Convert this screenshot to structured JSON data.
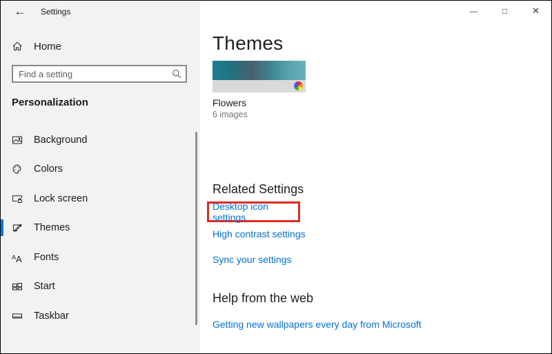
{
  "window": {
    "title": "Settings",
    "back_glyph": "←",
    "controls": {
      "minimize": "—",
      "maximize": "□",
      "close": "✕"
    }
  },
  "sidebar": {
    "home": {
      "label": "Home"
    },
    "search": {
      "placeholder": "Find a setting"
    },
    "section_header": "Personalization",
    "items": [
      {
        "label": "Background",
        "icon": "image-icon",
        "selected": false
      },
      {
        "label": "Colors",
        "icon": "palette-icon",
        "selected": false
      },
      {
        "label": "Lock screen",
        "icon": "lock-screen-icon",
        "selected": false
      },
      {
        "label": "Themes",
        "icon": "themes-icon",
        "selected": true
      },
      {
        "label": "Fonts",
        "icon": "fonts-icon",
        "selected": false
      },
      {
        "label": "Start",
        "icon": "start-tiles-icon",
        "selected": false
      },
      {
        "label": "Taskbar",
        "icon": "taskbar-icon",
        "selected": false
      }
    ]
  },
  "main": {
    "page_title": "Themes",
    "current_theme": {
      "name": "Flowers",
      "image_count": "6 images"
    },
    "related_settings": {
      "heading": "Related Settings",
      "links": [
        {
          "label": "Desktop icon settings",
          "highlighted": true
        },
        {
          "label": "High contrast settings",
          "highlighted": false
        },
        {
          "label": "Sync your settings",
          "highlighted": false
        }
      ]
    },
    "help": {
      "heading": "Help from the web",
      "links": [
        {
          "label": "Getting new wallpapers every day from Microsoft"
        }
      ]
    }
  },
  "colors": {
    "accent": "#0078d7",
    "link": "#0070d6",
    "annotation_box": "#e0291d",
    "sidebar_bg": "#f2f2f2",
    "thumbnail_strip": "#d9d9d9"
  }
}
